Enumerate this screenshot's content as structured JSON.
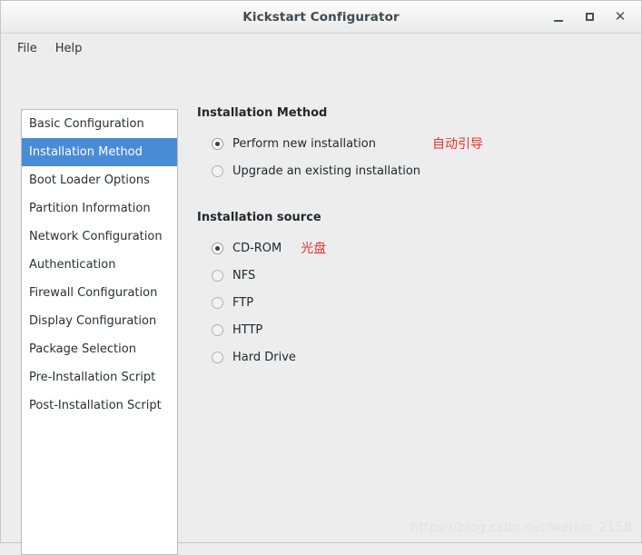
{
  "window": {
    "title": "Kickstart Configurator",
    "buttons": {
      "minimize": "minimize-icon",
      "maximize": "maximize-icon",
      "close": "close-icon"
    }
  },
  "menubar": {
    "items": [
      {
        "label": "File"
      },
      {
        "label": "Help"
      }
    ]
  },
  "sidebar": {
    "items": [
      {
        "label": "Basic Configuration",
        "selected": false
      },
      {
        "label": "Installation Method",
        "selected": true
      },
      {
        "label": "Boot Loader Options",
        "selected": false
      },
      {
        "label": "Partition Information",
        "selected": false
      },
      {
        "label": "Network Configuration",
        "selected": false
      },
      {
        "label": "Authentication",
        "selected": false
      },
      {
        "label": "Firewall Configuration",
        "selected": false
      },
      {
        "label": "Display Configuration",
        "selected": false
      },
      {
        "label": "Package Selection",
        "selected": false
      },
      {
        "label": "Pre-Installation Script",
        "selected": false
      },
      {
        "label": "Post-Installation Script",
        "selected": false
      }
    ],
    "selected_color": "#4a8bd8"
  },
  "main": {
    "installation_method": {
      "heading": "Installation Method",
      "options": [
        {
          "label": "Perform new installation",
          "checked": true
        },
        {
          "label": "Upgrade an existing installation",
          "checked": false
        }
      ],
      "annotation": "自动引导"
    },
    "installation_source": {
      "heading": "Installation source",
      "options": [
        {
          "label": "CD-ROM",
          "checked": true
        },
        {
          "label": "NFS",
          "checked": false
        },
        {
          "label": "FTP",
          "checked": false
        },
        {
          "label": "HTTP",
          "checked": false
        },
        {
          "label": "Hard Drive",
          "checked": false
        }
      ],
      "annotation": "光盘"
    },
    "annotation_color": "#f03232"
  },
  "watermark": {
    "text": "https://blog.csdn.net/weixin_2158"
  }
}
